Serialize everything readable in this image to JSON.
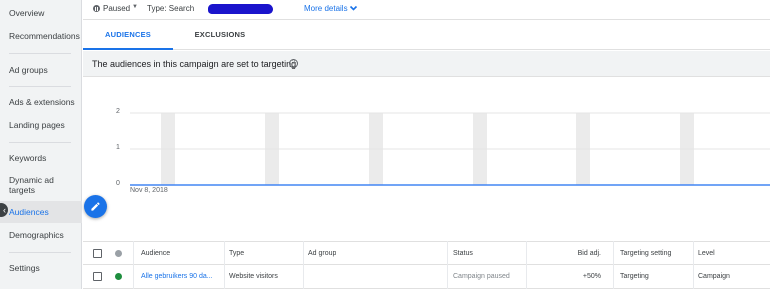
{
  "sidebar": {
    "items": [
      {
        "label": "Overview"
      },
      {
        "label": "Recommendations"
      },
      {
        "label": "Ad groups"
      },
      {
        "label": "Ads & extensions"
      },
      {
        "label": "Landing pages"
      },
      {
        "label": "Keywords"
      },
      {
        "label": "Dynamic ad targets"
      },
      {
        "label": "Audiences",
        "active": true
      },
      {
        "label": "Demographics"
      },
      {
        "label": "Settings"
      }
    ]
  },
  "topbar": {
    "status": "Paused",
    "type": "Type: Search",
    "more_details": "More details"
  },
  "tabs": [
    {
      "label": "AUDIENCES",
      "active": true
    },
    {
      "label": "EXCLUSIONS",
      "active": false
    }
  ],
  "info": {
    "text": "The audiences in this campaign are set to targeting"
  },
  "chart_data": {
    "type": "line",
    "x_start_label": "Nov 8, 2018",
    "yticks": [
      0,
      1,
      2
    ],
    "ylim": [
      0,
      2
    ],
    "series": [
      {
        "values": [
          0,
          0,
          0,
          0,
          0,
          0,
          0,
          0,
          0,
          0,
          0,
          0,
          0,
          0,
          0
        ]
      }
    ],
    "grid": true,
    "colors": {
      "line": "#4285f4",
      "bands": "#ebebeb",
      "grid": "#e6e6e6"
    }
  },
  "table": {
    "headers": [
      "Audience",
      "Type",
      "Ad group",
      "Status",
      "Bid adj.",
      "Targeting setting",
      "Level"
    ],
    "rows": [
      {
        "audience": "Alle gebruikers 90 da...",
        "type": "Website visitors",
        "ad_group": "",
        "status": "Campaign paused",
        "bid_adj": "+50%",
        "targeting_setting": "Targeting",
        "level": "Campaign"
      }
    ]
  },
  "colors": {
    "accent": "#1a73e8",
    "enabled": "#1e8e3e",
    "header_dot": "#9aa0a6"
  }
}
